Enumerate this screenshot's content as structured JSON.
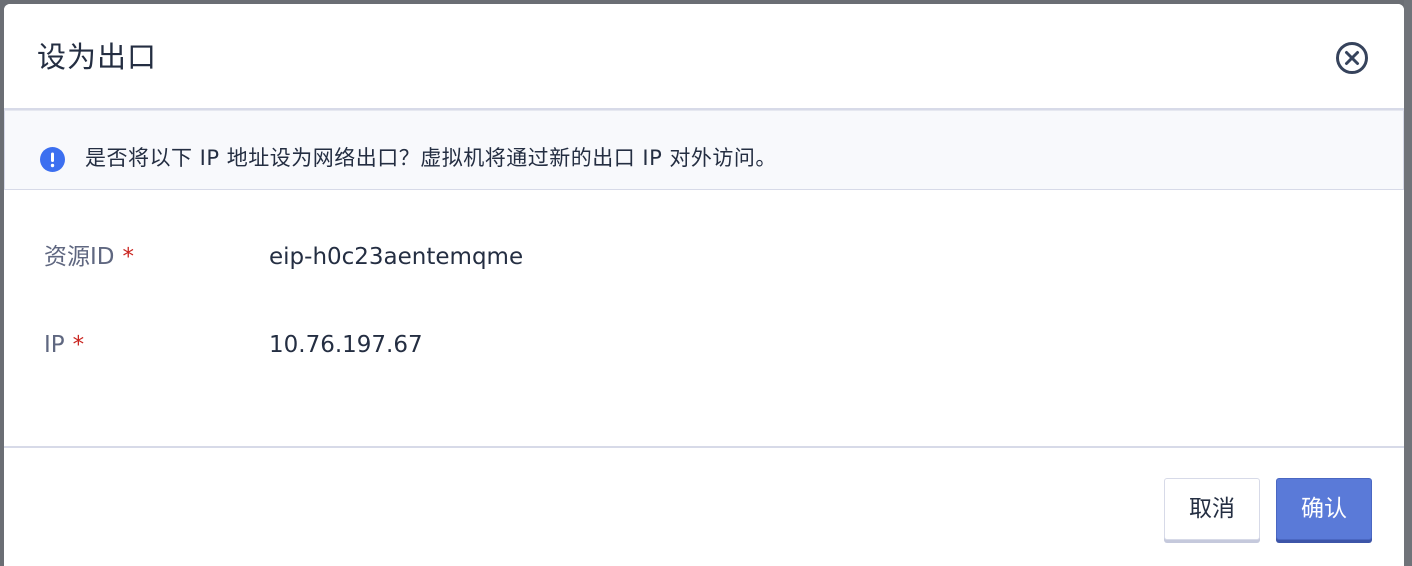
{
  "dialog": {
    "title": "设为出口",
    "close_icon": "close-circle-icon"
  },
  "notice": {
    "icon": "exclamation-circle-icon",
    "icon_color": "#3c6ff0",
    "text": "是否将以下 IP 地址设为网络出口？虚拟机将通过新的出口 IP 对外访问。"
  },
  "fields": {
    "resource_id": {
      "label": "资源ID",
      "required_mark": "*",
      "value": "eip-h0c23aentemqme"
    },
    "ip": {
      "label": "IP",
      "required_mark": "*",
      "value": "10.76.197.67"
    }
  },
  "footer": {
    "cancel_label": "取消",
    "confirm_label": "确认"
  },
  "colors": {
    "primary": "#5a7ad8",
    "required": "#ca2621",
    "text_primary": "#242e42",
    "text_secondary": "#5f6780"
  }
}
